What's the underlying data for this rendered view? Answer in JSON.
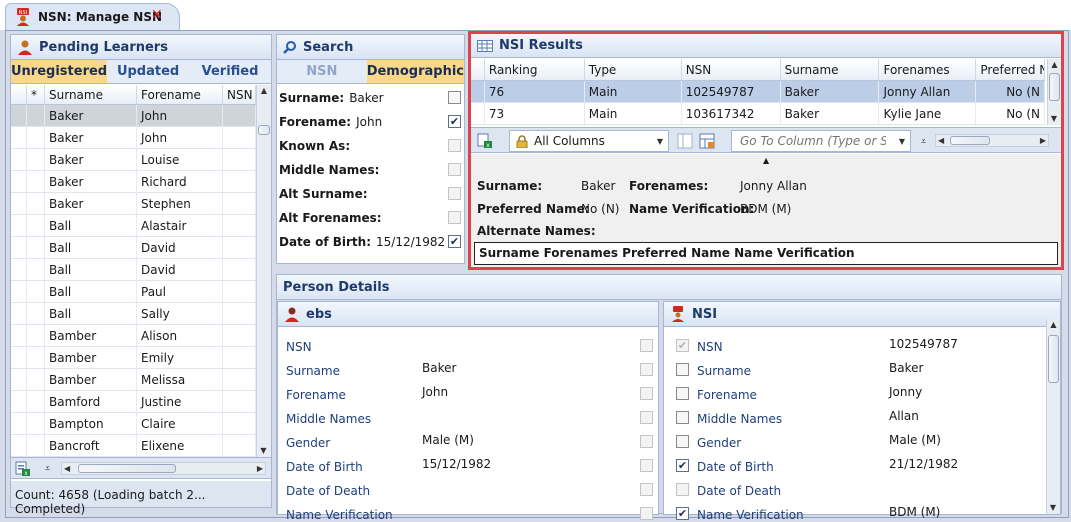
{
  "window": {
    "tab_title": "NSN: Manage NSN",
    "tab_close": "✕"
  },
  "pending": {
    "title": "Pending Learners",
    "tabs": [
      {
        "label": "Unregistered",
        "active": true
      },
      {
        "label": "Updated",
        "active": false
      },
      {
        "label": "Verified",
        "active": false
      }
    ],
    "columns": [
      "*",
      "Surname",
      "Forename",
      "NSN"
    ],
    "rows": [
      {
        "surname": "Baker",
        "forename": "John"
      },
      {
        "surname": "Baker",
        "forename": "John"
      },
      {
        "surname": "Baker",
        "forename": "Louise"
      },
      {
        "surname": "Baker",
        "forename": "Richard"
      },
      {
        "surname": "Baker",
        "forename": "Stephen"
      },
      {
        "surname": "Ball",
        "forename": "Alastair"
      },
      {
        "surname": "Ball",
        "forename": "David"
      },
      {
        "surname": "Ball",
        "forename": "David"
      },
      {
        "surname": "Ball",
        "forename": "Paul"
      },
      {
        "surname": "Ball",
        "forename": "Sally"
      },
      {
        "surname": "Bamber",
        "forename": "Alison"
      },
      {
        "surname": "Bamber",
        "forename": "Emily"
      },
      {
        "surname": "Bamber",
        "forename": "Melissa"
      },
      {
        "surname": "Bamford",
        "forename": "Justine"
      },
      {
        "surname": "Bampton",
        "forename": "Claire"
      },
      {
        "surname": "Bancroft",
        "forename": "Elixene"
      }
    ],
    "status": "Count: 4658 (Loading batch 2... Completed)"
  },
  "search": {
    "title": "Search",
    "tabs": [
      {
        "label": "NSN",
        "active": false
      },
      {
        "label": "Demographic",
        "active": true
      }
    ],
    "criteria": [
      {
        "label": "Surname:",
        "value": "Baker",
        "checked": false
      },
      {
        "label": "Forename:",
        "value": "John",
        "checked": true
      },
      {
        "label": "Known As:",
        "value": "",
        "checked": false,
        "disabled": true
      },
      {
        "label": "Middle Names:",
        "value": "",
        "checked": false,
        "disabled": true
      },
      {
        "label": "Alt Surname:",
        "value": "",
        "checked": false,
        "disabled": true
      },
      {
        "label": "Alt Forenames:",
        "value": "",
        "checked": false,
        "disabled": true
      },
      {
        "label": "Date of Birth:",
        "value": "15/12/1982",
        "checked": true
      }
    ]
  },
  "results": {
    "title": "NSI Results",
    "columns": [
      "Ranking",
      "Type",
      "NSN",
      "Surname",
      "Forenames",
      "Preferred N"
    ],
    "rows": [
      {
        "ranking": "76",
        "type": "Main",
        "nsn": "102549787",
        "surname": "Baker",
        "forenames": "Jonny Allan",
        "preferred": "No (N"
      },
      {
        "ranking": "73",
        "type": "Main",
        "nsn": "103617342",
        "surname": "Baker",
        "forenames": "Kylie Jane",
        "preferred": "No (N"
      }
    ],
    "toolbar": {
      "columns_combo": "All Columns",
      "goto_placeholder": "Go To Column (Type or Select)"
    },
    "detail": {
      "surname_label": "Surname:",
      "surname": "Baker",
      "forenames_label": "Forenames:",
      "forenames": "Jonny Allan",
      "preferred_label": "Preferred Name:",
      "preferred": "No (N)",
      "verification_label": "Name Verification:",
      "verification": "BDM (M)",
      "alternate_label": "Alternate Names:",
      "alternate_columns": "Surname Forenames Preferred Name Name Verification"
    }
  },
  "person": {
    "title": "Person Details",
    "ebs": {
      "title": "ebs",
      "fields": [
        {
          "label": "NSN",
          "value": ""
        },
        {
          "label": "Surname",
          "value": "Baker"
        },
        {
          "label": "Forename",
          "value": "John"
        },
        {
          "label": "Middle Names",
          "value": ""
        },
        {
          "label": "Gender",
          "value": "Male (M)"
        },
        {
          "label": "Date of Birth",
          "value": "15/12/1982"
        },
        {
          "label": "Date of Death",
          "value": ""
        },
        {
          "label": "Name Verification",
          "value": ""
        }
      ]
    },
    "nsi": {
      "title": "NSI",
      "fields": [
        {
          "label": "NSN",
          "value": "102549787",
          "checked": true,
          "disabled": true
        },
        {
          "label": "Surname",
          "value": "Baker",
          "checked": false
        },
        {
          "label": "Forename",
          "value": "Jonny",
          "checked": false
        },
        {
          "label": "Middle Names",
          "value": "Allan",
          "checked": false
        },
        {
          "label": "Gender",
          "value": "Male (M)",
          "checked": false
        },
        {
          "label": "Date of Birth",
          "value": "21/12/1982",
          "checked": true
        },
        {
          "label": "Date of Death",
          "value": "",
          "checked": false,
          "disabled": true
        },
        {
          "label": "Name Verification",
          "value": "BDM (M)",
          "checked": true
        }
      ]
    }
  },
  "colors": {
    "accent_tab": "#fbd889",
    "frame_highlight": "#d9454b",
    "header_text": "#1d3a6b"
  }
}
